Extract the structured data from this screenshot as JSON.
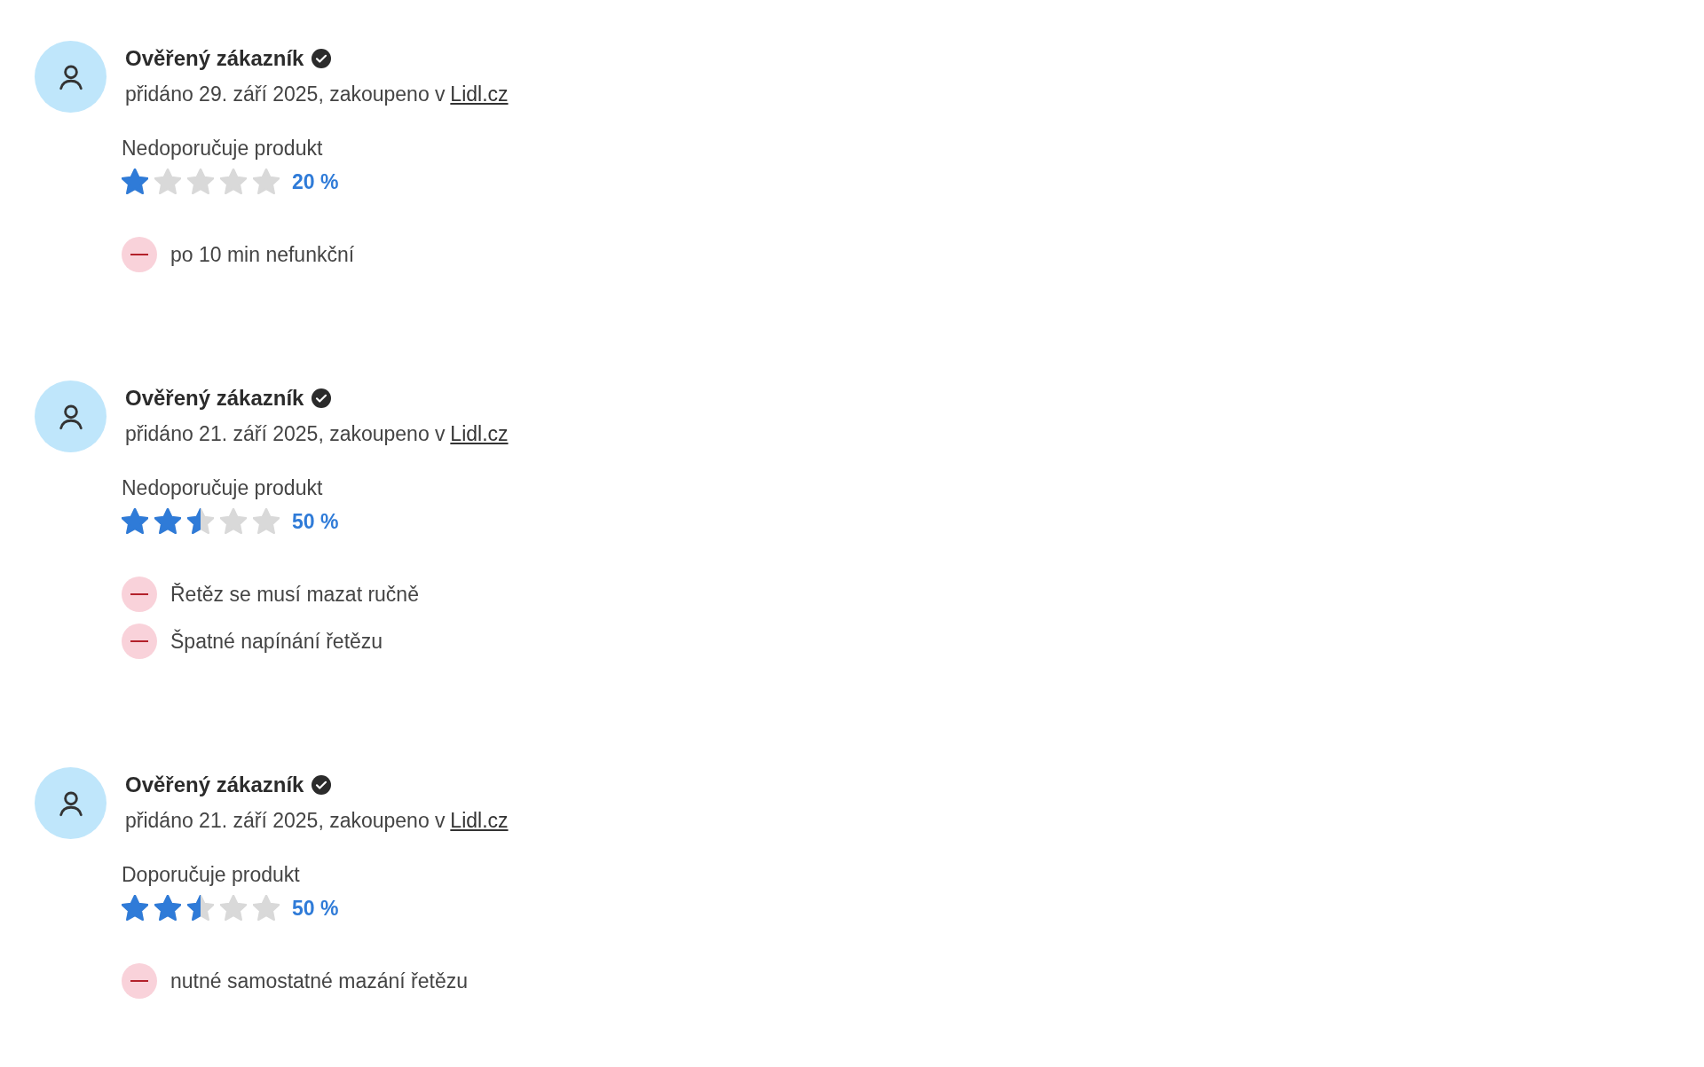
{
  "reviews": [
    {
      "author": "Ověřený zákazník",
      "verified": true,
      "date_line": "přidáno 29. září 2025, zakoupeno v",
      "store_link": "Lidl.cz",
      "recommendation": "Nedoporučuje produkt",
      "stars": 1,
      "percent": "20 %",
      "cons": [
        "po 10 min nefunkční"
      ]
    },
    {
      "author": "Ověřený zákazník",
      "verified": true,
      "date_line": "přidáno 21. září 2025, zakoupeno v",
      "store_link": "Lidl.cz",
      "recommendation": "Nedoporučuje produkt",
      "stars": 2.5,
      "percent": "50 %",
      "cons": [
        "Řetěz se musí mazat ručně",
        "Špatné napínání řetězu"
      ]
    },
    {
      "author": "Ověřený zákazník",
      "verified": true,
      "date_line": "přidáno 21. září 2025, zakoupeno v",
      "store_link": "Lidl.cz",
      "recommendation": "Doporučuje produkt",
      "stars": 2.5,
      "percent": "50 %",
      "cons": [
        "nutné samostatné mazání řetězu"
      ]
    }
  ]
}
